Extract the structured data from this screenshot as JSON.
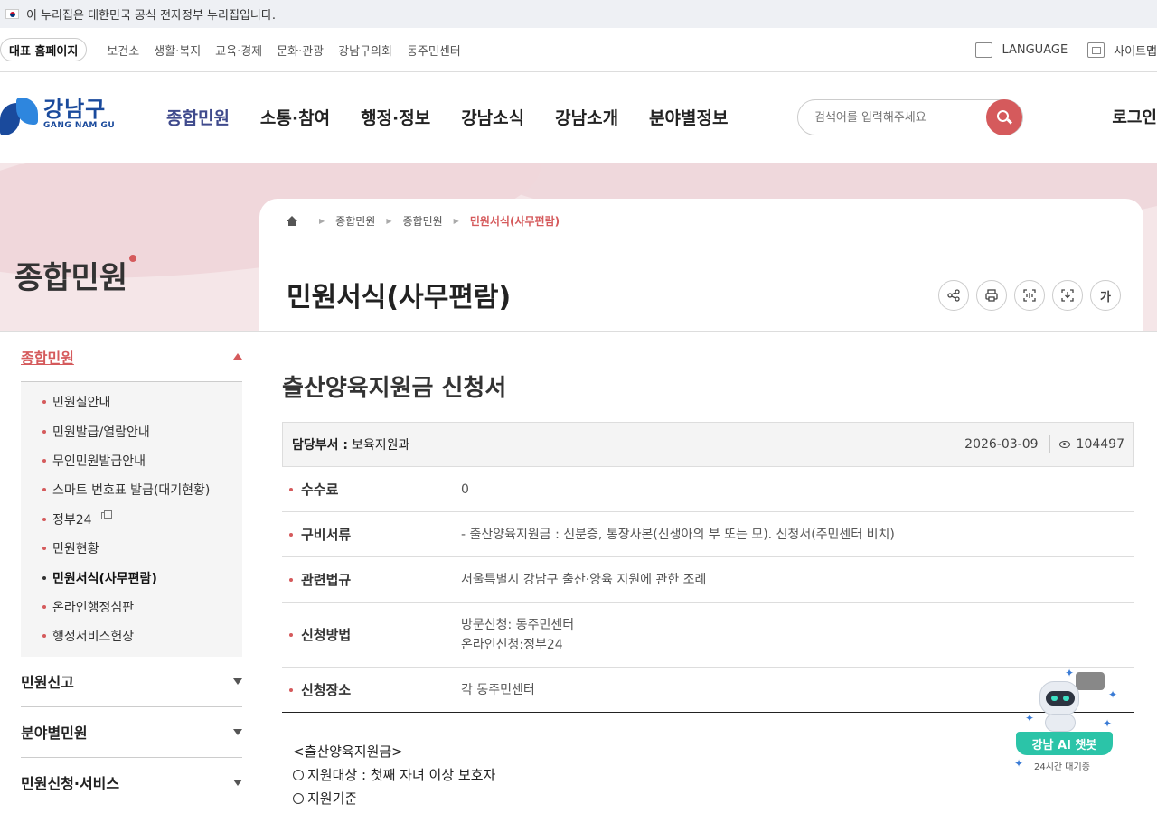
{
  "gov_banner": {
    "text": "이 누리집은 대한민국 공식 전자정부 누리집입니다."
  },
  "util": {
    "home": "대표 홈페이지",
    "links": [
      "보건소",
      "생활·복지",
      "교육·경제",
      "문화·관광",
      "강남구의회",
      "동주민센터"
    ],
    "language": "LANGUAGE",
    "sitemap": "사이트맵"
  },
  "header": {
    "logo_kr": "강남구",
    "logo_en": "GANG NAM GU",
    "gnb": [
      "종합민원",
      "소통·참여",
      "행정·정보",
      "강남소식",
      "강남소개",
      "분야별정보"
    ],
    "search_placeholder": "검색어를 입력해주세요",
    "login": "로그인"
  },
  "visual": {
    "section_title": "종합민원"
  },
  "breadcrumb": [
    "종합민원",
    "종합민원",
    "민원서식(사무편람)"
  ],
  "page_title": "민원서식(사무편람)",
  "tools": {
    "font": "가"
  },
  "lnb": {
    "top": "종합민원",
    "items": [
      "민원실안내",
      "민원발급/열람안내",
      "무인민원발급안내",
      "스마트 번호표 발급(대기현황)",
      "정부24",
      "민원현황",
      "민원서식(사무편람)",
      "온라인행정심판",
      "행정서비스헌장"
    ],
    "groups": [
      "민원신고",
      "분야별민원",
      "민원신청·서비스"
    ]
  },
  "doc": {
    "title": "출산양육지원금 신청서",
    "dept_label": "담당부서 :",
    "dept": "보육지원과",
    "date": "2026-03-09",
    "views": "104497",
    "rows": [
      {
        "k": "수수료",
        "v": [
          "0"
        ]
      },
      {
        "k": "구비서류",
        "v": [
          "- 출산양육지원금 : 신분증, 통장사본(신생아의 부 또는 모). 신청서(주민센터 비치)"
        ]
      },
      {
        "k": "관련법규",
        "v": [
          "서울특별시 강남구 출산·양육 지원에 관한 조례"
        ]
      },
      {
        "k": "신청방법",
        "v": [
          "방문신청: 동주민센터",
          "온라인신청:정부24"
        ]
      },
      {
        "k": "신청장소",
        "v": [
          "각 동주민센터"
        ]
      }
    ],
    "body": [
      "<출산양육지원금>",
      "지원대상 : 첫째 자녀 이상 보호자",
      "지원기준"
    ]
  },
  "chatbot": {
    "label": "강남 AI 챗봇",
    "sub": "24시간 대기중"
  }
}
